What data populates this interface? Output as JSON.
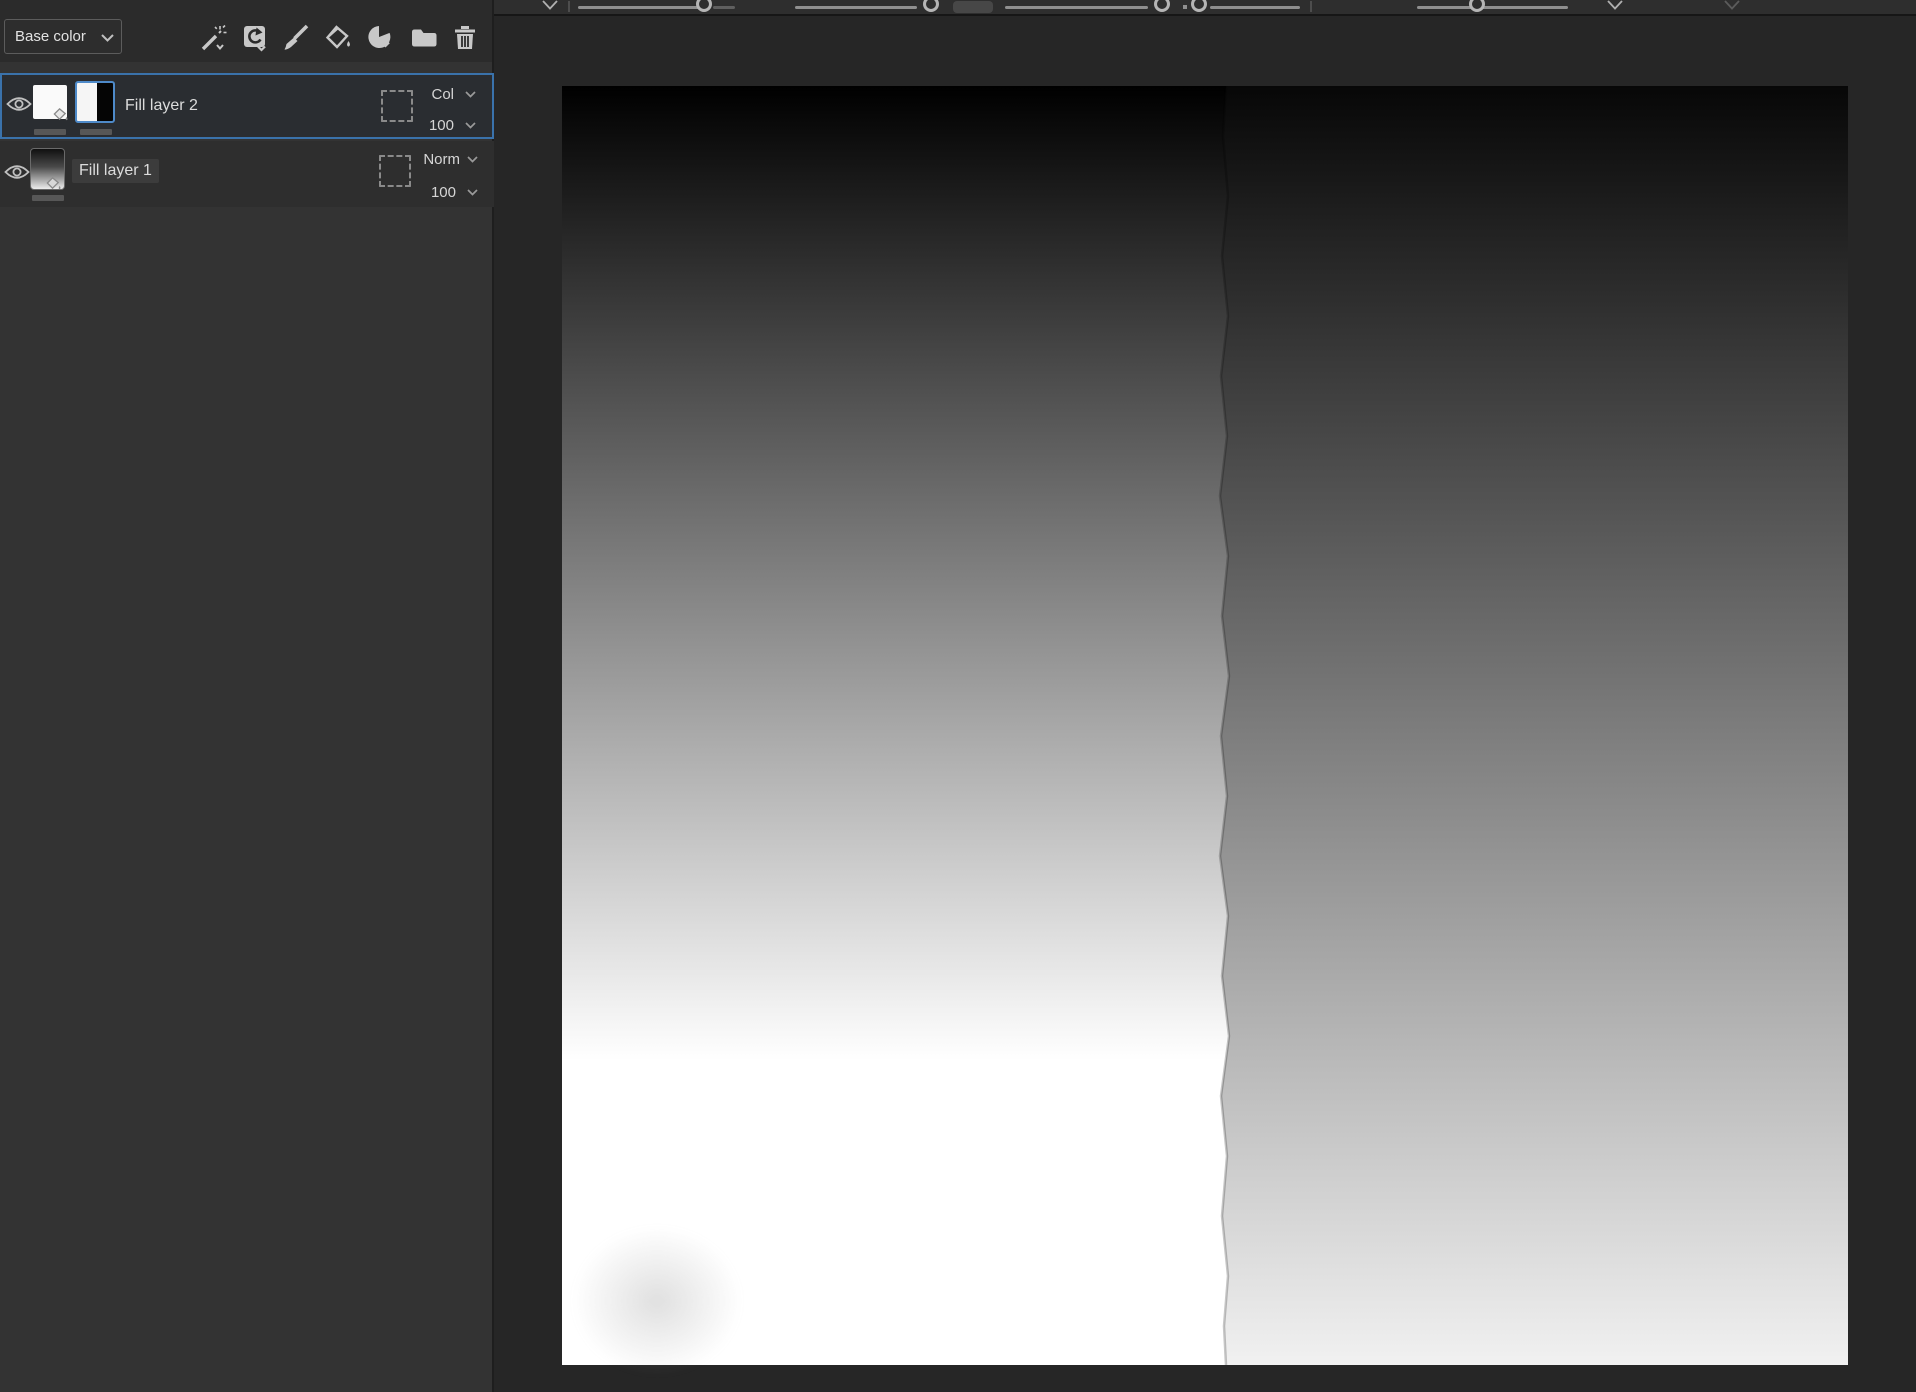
{
  "layers_panel": {
    "channel_dropdown": {
      "value": "Base color"
    },
    "toolbar": {
      "icons": [
        "magic-wand",
        "fill-effect",
        "paint-brush",
        "paint-bucket",
        "mask-pie",
        "folder",
        "trash"
      ]
    },
    "layers": [
      {
        "name": "Fill layer 2",
        "blend_mode": "Col",
        "opacity": "100",
        "selected": true,
        "visible": true,
        "has_mask": true
      },
      {
        "name": "Fill layer 1",
        "blend_mode": "Norm",
        "opacity": "100",
        "selected": false,
        "visible": true,
        "has_mask": false
      }
    ]
  },
  "colors": {
    "selection_blue": "#3a72ab",
    "mask_border_blue": "#4e8ac9",
    "panel_bg": "#333333",
    "row_bg": "#2e2e2e",
    "canvas_area_bg": "#262626"
  },
  "canvas": {
    "left_gradient": {
      "top": "#000000",
      "bottom": "#ffffff",
      "white_reached_at": "76%"
    },
    "right_gradient": {
      "top": "#070707",
      "bottom": "#f1f1f1"
    },
    "divider_position": "51.5%"
  }
}
